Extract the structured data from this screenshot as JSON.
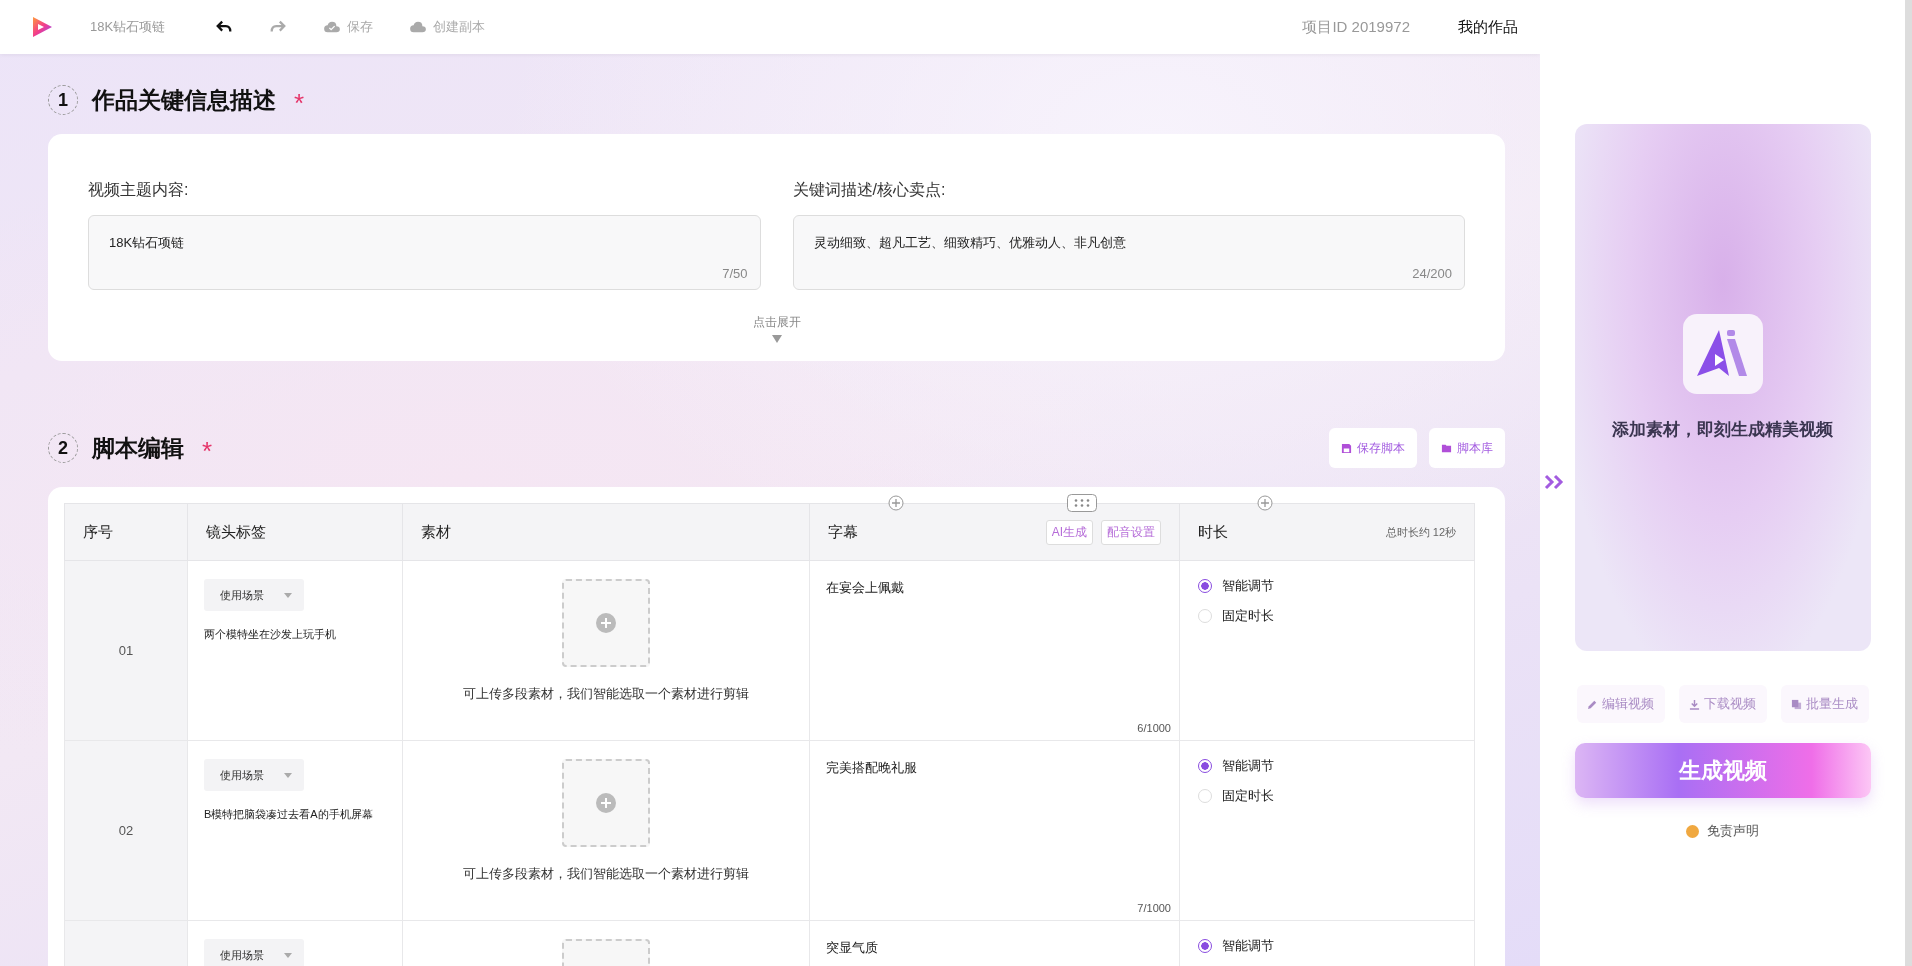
{
  "top_bar": {
    "project_name": "18K钻石项链",
    "actions": [
      {
        "kind": "undo",
        "disabled": false
      },
      {
        "kind": "redo",
        "disabled": true
      },
      {
        "kind": "save",
        "label": "保存",
        "disabled": true
      },
      {
        "kind": "copy",
        "label": "创建副本",
        "disabled": true
      }
    ],
    "project_id": "项目ID 2019972",
    "my_works": "我的作品"
  },
  "section_1": {
    "number": "1",
    "title": "作品关键信息描述",
    "required_mark": "*",
    "fields": [
      {
        "label": "视频主题内容:",
        "value": "18K钻石项链",
        "count": "7/50"
      },
      {
        "label": "关键词描述/核心卖点:",
        "value": "灵动细致、超凡工艺、细致精巧、优雅动人、非凡创意",
        "count": "24/200"
      }
    ],
    "expand": "点击展开"
  },
  "section_2": {
    "number": "2",
    "title": "脚本编辑",
    "required_mark": "*",
    "buttons": [
      {
        "kind": "save",
        "label": "保存脚本"
      },
      {
        "kind": "library",
        "label": "脚本库"
      }
    ],
    "table": {
      "columns": [
        {
          "label": "序号"
        },
        {
          "label": "镜头标签"
        },
        {
          "label": "素材"
        },
        {
          "label": "字幕",
          "buttons": [
            "AI生成",
            "配音设置"
          ]
        },
        {
          "label": "时长",
          "note": "总时长约 12秒"
        }
      ],
      "rows": [
        {
          "index": "01",
          "tag": "使用场景",
          "description": "两个模特坐在沙发上玩手机",
          "upload_hint": "可上传多段素材，我们智能选取一个素材进行剪辑",
          "subtitle": "在宴会上佩戴",
          "count": "6/1000",
          "duration_options": [
            {
              "label": "智能调节",
              "selected": true
            },
            {
              "label": "固定时长",
              "selected": false
            }
          ]
        },
        {
          "index": "02",
          "tag": "使用场景",
          "description": "B模特把脑袋凑过去看A的手机屏幕",
          "upload_hint": "可上传多段素材，我们智能选取一个素材进行剪辑",
          "subtitle": "完美搭配晚礼服",
          "count": "7/1000",
          "duration_options": [
            {
              "label": "智能调节",
              "selected": true
            },
            {
              "label": "固定时长",
              "selected": false
            }
          ]
        },
        {
          "tag": "使用场景",
          "subtitle": "突显气质",
          "duration_options": [
            {
              "label": "智能调节",
              "selected": true
            }
          ]
        }
      ]
    }
  },
  "side_panel": {
    "message": "添加素材，即刻生成精美视频",
    "actions": [
      {
        "kind": "edit",
        "label": "编辑视频",
        "disabled": true
      },
      {
        "kind": "download",
        "label": "下载视频",
        "disabled": true
      },
      {
        "kind": "batch",
        "label": "批量生成",
        "disabled": true
      }
    ],
    "generate": "生成视频",
    "disclaimer": "免责声明"
  }
}
